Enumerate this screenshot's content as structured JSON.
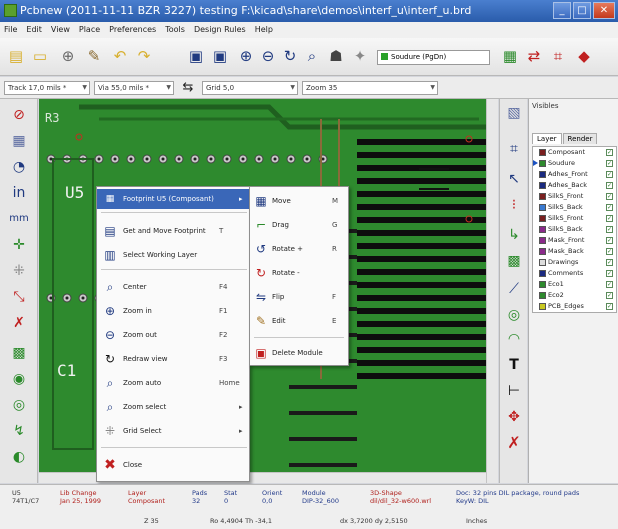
{
  "window": {
    "title": "Pcbnew (2011-11-11 BZR 3227) testing F:\\kicad\\share\\demos\\interf_u\\interf_u.brd",
    "controls": [
      "_",
      "□",
      "✕"
    ]
  },
  "menubar": [
    "File",
    "Edit",
    "View",
    "Place",
    "Preferences",
    "Tools",
    "Design Rules",
    "Help"
  ],
  "toolbar": {
    "layer_select": "Soudure (PgDn)"
  },
  "toolbar2": {
    "track": "Track 17,0 mils *",
    "via": "Via 55,0 mils *",
    "grid": "Grid 5,0",
    "zoom": "Zoom 35"
  },
  "canvas": {
    "labels": [
      "R3",
      "U5",
      "C1"
    ]
  },
  "context_menu": {
    "items": [
      {
        "label": "Footprint U5 (Composant)",
        "accel": "",
        "submenu": true
      },
      {
        "label": "Get and Move Footprint",
        "accel": "T",
        "submenu": false
      },
      {
        "label": "Select Working Layer",
        "accel": "",
        "submenu": false
      },
      {
        "label": "Center",
        "accel": "F4",
        "submenu": false
      },
      {
        "label": "Zoom in",
        "accel": "F1",
        "submenu": false
      },
      {
        "label": "Zoom out",
        "accel": "F2",
        "submenu": false
      },
      {
        "label": "Redraw view",
        "accel": "F3",
        "submenu": false
      },
      {
        "label": "Zoom auto",
        "accel": "Home",
        "submenu": false
      },
      {
        "label": "Zoom select",
        "accel": "",
        "submenu": true
      },
      {
        "label": "Grid Select",
        "accel": "",
        "submenu": true
      },
      {
        "label": "Close",
        "accel": "",
        "submenu": false
      }
    ]
  },
  "submenu": {
    "items": [
      {
        "label": "Move",
        "accel": "M"
      },
      {
        "label": "Drag",
        "accel": "G"
      },
      {
        "label": "Rotate +",
        "accel": "R"
      },
      {
        "label": "Rotate -",
        "accel": ""
      },
      {
        "label": "Flip",
        "accel": "F"
      },
      {
        "label": "Edit",
        "accel": "E"
      },
      {
        "label": "Delete Module",
        "accel": ""
      }
    ]
  },
  "layers_panel": {
    "title": "Visibles",
    "tabs": [
      "Layer",
      "Render"
    ],
    "layers": [
      {
        "name": "Composant",
        "color": "#7a2020",
        "current": false
      },
      {
        "name": "Soudure",
        "color": "#2e8a2e",
        "current": true
      },
      {
        "name": "Adhes_Front",
        "color": "#1a2a80",
        "current": false
      },
      {
        "name": "Adhes_Back",
        "color": "#1a2a80",
        "current": false
      },
      {
        "name": "SilkS_Front",
        "color": "#7a2020",
        "current": false
      },
      {
        "name": "SilkS_Back",
        "color": "#3a7ad0",
        "current": false
      },
      {
        "name": "SilkS_Front",
        "color": "#7a2020",
        "current": false
      },
      {
        "name": "SilkS_Back",
        "color": "#8a2a8a",
        "current": false
      },
      {
        "name": "Mask_Front",
        "color": "#8a2a8a",
        "current": false
      },
      {
        "name": "Mask_Back",
        "color": "#8a2a8a",
        "current": false
      },
      {
        "name": "Drawings",
        "color": "#dddddd",
        "current": false
      },
      {
        "name": "Comments",
        "color": "#1a2a80",
        "current": false
      },
      {
        "name": "Eco1",
        "color": "#2e8a2e",
        "current": false
      },
      {
        "name": "Eco2",
        "color": "#2e8a2e",
        "current": false
      },
      {
        "name": "PCB_Edges",
        "color": "#c8c820",
        "current": false
      }
    ]
  },
  "statusbar": {
    "ref": "U5",
    "val": "74T1/C7",
    "lib_label": "Lib Change",
    "lib_value": "Jan 25, 1999",
    "layer_label": "Layer",
    "layer_value": "Composant",
    "pads_label": "Pads",
    "pads_value": "32",
    "stat_label": "Stat",
    "stat_value": "0",
    "orient_label": "Orient",
    "orient_value": "0,0",
    "module_label": "Module",
    "module_value": "DIP-32_600",
    "shape_label": "3D-Shape",
    "shape_value": "dil/dil_32-w600.wrl",
    "doc": "Doc: 32 pins DIL package, round pads",
    "keyw": "KeyW: DIL",
    "zoom": "Z 35",
    "coords": "Ro 4,4904 Th -34,1",
    "delta": "dx 3,7200 dy 2,5150",
    "units": "Inches"
  }
}
